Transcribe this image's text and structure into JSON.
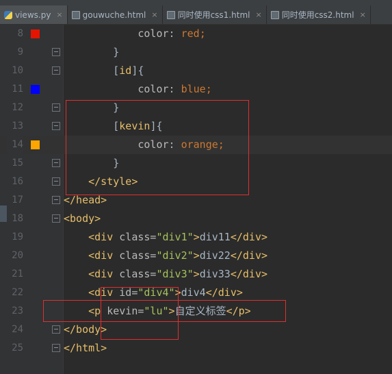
{
  "tabs": [
    {
      "label": "views.py",
      "icon": "python-file-icon",
      "active": true
    },
    {
      "label": "gouwuche.html",
      "icon": "html-file-icon",
      "active": false
    },
    {
      "label": "同时使用css1.html",
      "icon": "html-file-icon",
      "active": false
    },
    {
      "label": "同时使用css2.html",
      "icon": "html-file-icon",
      "active": false
    }
  ],
  "tab_close_glyph": "×",
  "colors": {
    "red": "#e51400",
    "blue": "#0000ff",
    "orange": "#ffa500",
    "annotation": "#e03030"
  },
  "lines": [
    {
      "num": "8",
      "t": [
        "            ",
        "color",
        ": ",
        "red",
        ";"
      ]
    },
    {
      "num": "9",
      "t": [
        "        ",
        "}"
      ]
    },
    {
      "num": "10",
      "t": [
        "        ",
        "[",
        "id",
        "]{"
      ]
    },
    {
      "num": "11",
      "t": [
        "            ",
        "color",
        ": ",
        "blue",
        ";"
      ]
    },
    {
      "num": "12",
      "t": [
        "        ",
        "}"
      ]
    },
    {
      "num": "13",
      "t": [
        "        ",
        "[",
        "kevin",
        "]{"
      ]
    },
    {
      "num": "14",
      "t": [
        "            ",
        "color",
        ": ",
        "orange",
        ";"
      ]
    },
    {
      "num": "15",
      "t": [
        "        ",
        "}"
      ]
    },
    {
      "num": "16",
      "t": [
        "    ",
        "</style>"
      ]
    },
    {
      "num": "17",
      "t": [
        "",
        "</head>"
      ]
    },
    {
      "num": "18",
      "t": [
        "",
        "<body>"
      ]
    },
    {
      "num": "19",
      "t": [
        "    ",
        "<div ",
        "class=",
        "\"div1\"",
        ">",
        "div11",
        "</div>"
      ]
    },
    {
      "num": "20",
      "t": [
        "    ",
        "<div ",
        "class=",
        "\"div2\"",
        ">",
        "div22",
        "</div>"
      ]
    },
    {
      "num": "21",
      "t": [
        "    ",
        "<div ",
        "class=",
        "\"div3\"",
        ">",
        "div33",
        "</div>"
      ]
    },
    {
      "num": "22",
      "t": [
        "    ",
        "<div ",
        "id=",
        "\"div4\"",
        ">",
        "div4",
        "</div>"
      ]
    },
    {
      "num": "23",
      "t": [
        "    ",
        "<p ",
        "kevin=",
        "\"lu\"",
        ">",
        "自定义标签",
        "</p>"
      ]
    },
    {
      "num": "24",
      "t": [
        "",
        "</body>"
      ]
    },
    {
      "num": "25",
      "t": [
        "",
        "</html>"
      ]
    }
  ]
}
